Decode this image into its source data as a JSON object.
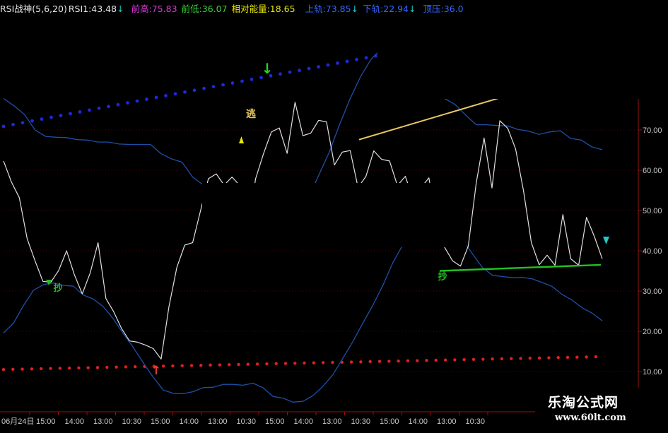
{
  "header": {
    "indicator_name": "RSI战神(5,6,20)",
    "rsi": "RSI1:43.48",
    "rsi_arrow": "↓",
    "prev_high": "前高:75.83",
    "prev_low": "前低:36.07",
    "relative_energy": "相对能量:18.65",
    "upper_band": "上轨:73.85",
    "upper_arrow": "↓",
    "lower_band": "下轨:22.94",
    "lower_arrow": "↓",
    "top_label": "顶压:36.0"
  },
  "colors": {
    "background": "#000000",
    "rsi_line": "#e0e0e0",
    "band": "#1f4fa8",
    "blue_dots": "#1c2ad8",
    "red_dots": "#e02020",
    "resistance": "#e8c860",
    "support": "#22c022",
    "grid": "#5a0000",
    "axis": "#9a1010",
    "tick": "#c8c8c8",
    "header_white": "#e6e6e6",
    "header_magenta": "#d83cd8",
    "header_green": "#38d838",
    "header_yellow": "#e8e800",
    "header_blue": "#3366ff",
    "header_cyan": "#22c8c8"
  },
  "chart_data": {
    "type": "line",
    "ylim": [
      0,
      85
    ],
    "y_ticks": [
      "10.00",
      "20.00",
      "30.00",
      "40.00",
      "50.00",
      "60.00",
      "70.00"
    ],
    "y_tick_values": [
      10,
      20,
      30,
      40,
      50,
      60,
      70
    ],
    "x_tick_labels": [
      "06月24日",
      "15:00",
      "14:00",
      "13:00",
      "10:30",
      "15:00",
      "14:00",
      "13:00",
      "10:30",
      "15:00",
      "14:00",
      "13:00",
      "10:30",
      "15:00",
      "14:00",
      "13:00",
      "10:30"
    ],
    "series": [
      {
        "values": [
          62.3,
          57.1,
          53.2,
          43.0,
          37.5,
          32.4,
          32.2,
          35.1,
          40.0,
          34.0,
          29.3,
          34.5,
          42.0,
          28.1,
          24.8,
          20.6,
          17.6,
          17.3,
          16.6,
          15.7,
          13.1,
          26.1,
          35.9,
          41.4,
          42.0,
          49.9,
          57.9,
          59.1,
          56.3,
          58.3,
          56.2,
          45.4,
          57.9,
          64.1,
          69.5,
          70.5,
          64.2,
          76.9,
          68.6,
          69.2,
          72.4,
          72.0,
          61.3,
          64.5,
          64.9,
          55.7,
          58.5,
          64.8,
          62.7,
          62.3,
          56.2,
          58.5,
          52.8,
          55.7,
          58.1,
          46.0,
          40.8,
          37.5,
          36.2,
          41.2,
          56.8,
          68.0,
          55.6,
          72.3,
          70.4,
          65.3,
          54.9,
          42.0,
          36.5,
          38.9,
          36.4,
          49.0,
          38.0,
          36.4,
          48.3,
          43.5,
          38.0
        ]
      },
      {
        "values": [
          77.8,
          76.0,
          73.8,
          70.0,
          68.4,
          68.2,
          68.1,
          67.6,
          67.5,
          67.0,
          67.0,
          66.5,
          66.4,
          66.4,
          66.4,
          64.1,
          62.8,
          62.0,
          58.3,
          56.4,
          53.2,
          51.3,
          49.1,
          46.3,
          44.6,
          42.2,
          42.3,
          44.4,
          48.5,
          53.1,
          58.7,
          64.4,
          71.4,
          77.8,
          83.3,
          87.6,
          90.2,
          91.3,
          91.0,
          88.6,
          83.8,
          79.6,
          77.8,
          76.3,
          73.7,
          71.3,
          71.3,
          71.1,
          71.0,
          70.1,
          69.7,
          68.9,
          69.5,
          69.8,
          67.9,
          67.5,
          65.8,
          65.1
        ]
      },
      {
        "values": [
          19.6,
          22.0,
          26.4,
          30.2,
          31.6,
          32.0,
          31.4,
          31.2,
          29.0,
          28.0,
          26.1,
          23.1,
          19.4,
          16.0,
          12.2,
          8.6,
          5.4,
          4.6,
          4.5,
          5.0,
          6.0,
          6.1,
          6.8,
          6.8,
          6.6,
          7.1,
          6.0,
          3.8,
          3.4,
          2.4,
          2.6,
          4.0,
          6.3,
          9.2,
          13.3,
          17.4,
          22.0,
          26.4,
          31.3,
          37.0,
          41.4,
          44.3,
          46.4,
          47.1,
          47.0,
          45.5,
          42.8,
          39.2,
          35.8,
          33.9,
          33.6,
          33.3,
          33.4,
          33.0,
          32.1,
          31.1,
          29.1,
          27.7,
          25.8,
          24.5,
          22.6
        ]
      }
    ],
    "resistance_line": [
      67.6,
      78.5
    ],
    "support_line": [
      35.0,
      36.5
    ],
    "blue_dots_range": [
      70.9,
      88.5
    ],
    "red_dots_range": [
      10.5,
      13.7
    ],
    "signals": {
      "sell_arrow": "↓",
      "escape": "逃",
      "buy_arrow": "↑",
      "bottom_1": "抄",
      "bottom_2": "抄"
    }
  },
  "watermark": {
    "title": "乐淘公式网",
    "url": "www.60lt.com"
  }
}
